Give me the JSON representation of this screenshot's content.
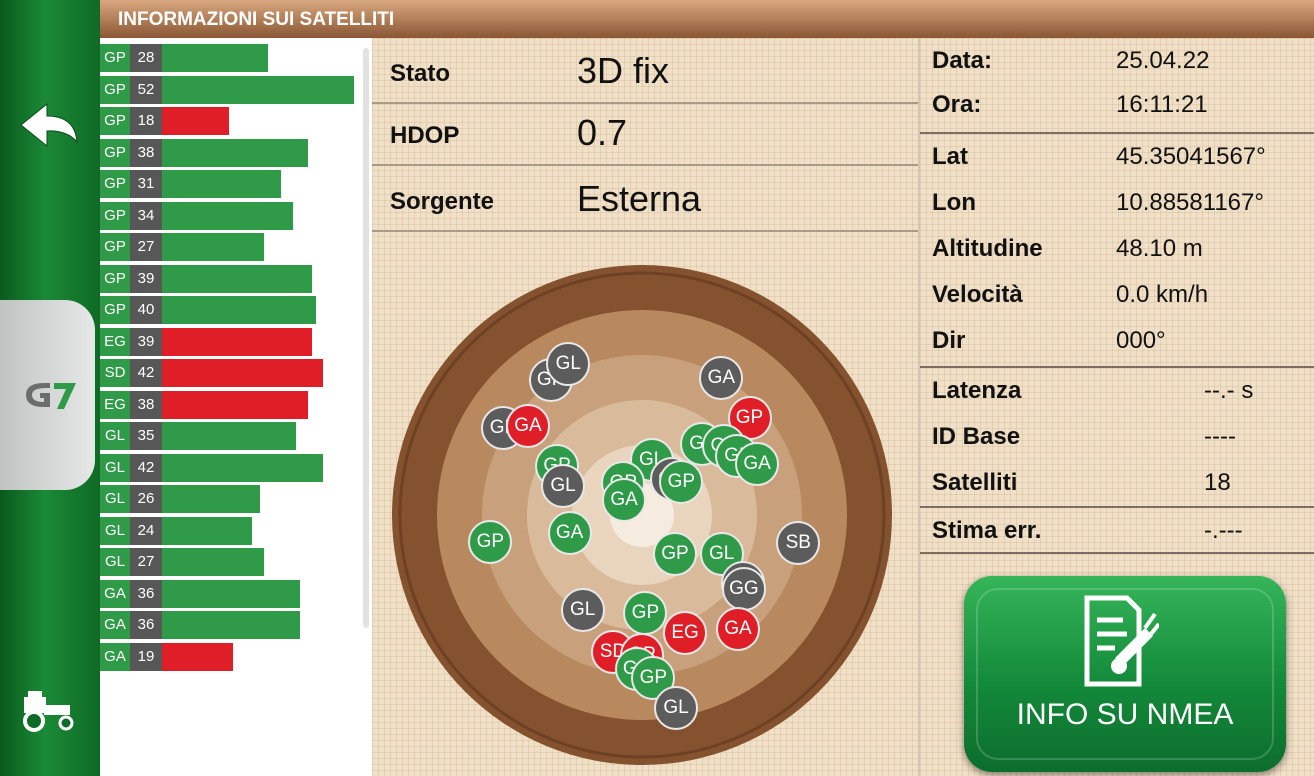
{
  "title": "INFORMAZIONI SUI SATELLITI",
  "sidebar": {
    "back_icon": "back-arrow-icon",
    "logo_icon": "g7-logo-icon",
    "tractor_icon": "tractor-icon"
  },
  "colors": {
    "good": "#2f9a48",
    "weak": "#e01e28",
    "inactive": "#5c5c5c",
    "accent": "#8a5634"
  },
  "satellites": [
    {
      "cons": "GP",
      "snr": "28",
      "level": 0.55,
      "status": "good"
    },
    {
      "cons": "GP",
      "snr": "52",
      "level": 1.0,
      "status": "good"
    },
    {
      "cons": "GP",
      "snr": "18",
      "level": 0.35,
      "status": "weak"
    },
    {
      "cons": "GP",
      "snr": "38",
      "level": 0.76,
      "status": "good"
    },
    {
      "cons": "GP",
      "snr": "31",
      "level": 0.62,
      "status": "good"
    },
    {
      "cons": "GP",
      "snr": "34",
      "level": 0.68,
      "status": "good"
    },
    {
      "cons": "GP",
      "snr": "27",
      "level": 0.53,
      "status": "good"
    },
    {
      "cons": "GP",
      "snr": "39",
      "level": 0.78,
      "status": "good"
    },
    {
      "cons": "GP",
      "snr": "40",
      "level": 0.8,
      "status": "good"
    },
    {
      "cons": "EG",
      "snr": "39",
      "level": 0.78,
      "status": "weak"
    },
    {
      "cons": "SD",
      "snr": "42",
      "level": 0.84,
      "status": "weak"
    },
    {
      "cons": "EG",
      "snr": "38",
      "level": 0.76,
      "status": "weak"
    },
    {
      "cons": "GL",
      "snr": "35",
      "level": 0.7,
      "status": "good"
    },
    {
      "cons": "GL",
      "snr": "42",
      "level": 0.84,
      "status": "good"
    },
    {
      "cons": "GL",
      "snr": "26",
      "level": 0.51,
      "status": "good"
    },
    {
      "cons": "GL",
      "snr": "24",
      "level": 0.47,
      "status": "good"
    },
    {
      "cons": "GL",
      "snr": "27",
      "level": 0.53,
      "status": "good"
    },
    {
      "cons": "GA",
      "snr": "36",
      "level": 0.72,
      "status": "good"
    },
    {
      "cons": "GA",
      "snr": "36",
      "level": 0.72,
      "status": "good"
    },
    {
      "cons": "GA",
      "snr": "19",
      "level": 0.37,
      "status": "weak"
    }
  ],
  "status": {
    "stato_label": "Stato",
    "stato_value": "3D fix",
    "hdop_label": "HDOP",
    "hdop_value": "0.7",
    "sorgente_label": "Sorgente",
    "sorgente_value": "Esterna"
  },
  "sky": [
    {
      "l": "GP",
      "s": "gray",
      "az": 326,
      "el": 20
    },
    {
      "l": "GL",
      "s": "gray",
      "az": 334,
      "el": 18
    },
    {
      "l": "GA",
      "s": "gray",
      "az": 30,
      "el": 22
    },
    {
      "l": "GP",
      "s": "red",
      "az": 48,
      "el": 28
    },
    {
      "l": "GP",
      "s": "gray",
      "az": 302,
      "el": 20
    },
    {
      "l": "GA",
      "s": "red",
      "az": 308,
      "el": 28
    },
    {
      "l": "GL",
      "s": "green",
      "az": 40,
      "el": 50
    },
    {
      "l": "GP",
      "s": "green",
      "az": 50,
      "el": 44
    },
    {
      "l": "GL",
      "s": "green",
      "az": 58,
      "el": 42
    },
    {
      "l": "GA",
      "s": "green",
      "az": 66,
      "el": 36
    },
    {
      "l": "GL",
      "s": "green",
      "az": 10,
      "el": 66
    },
    {
      "l": "GA",
      "s": "gray",
      "az": 40,
      "el": 70
    },
    {
      "l": "GP",
      "s": "green",
      "az": 50,
      "el": 68
    },
    {
      "l": "GP",
      "s": "green",
      "az": 300,
      "el": 48
    },
    {
      "l": "GL",
      "s": "gray",
      "az": 290,
      "el": 54
    },
    {
      "l": "GP",
      "s": "green",
      "az": 330,
      "el": 74
    },
    {
      "l": "GA",
      "s": "green",
      "az": 310,
      "el": 80
    },
    {
      "l": "GA",
      "s": "green",
      "az": 256,
      "el": 58
    },
    {
      "l": "GP",
      "s": "green",
      "az": 260,
      "el": 24
    },
    {
      "l": "GP",
      "s": "green",
      "az": 140,
      "el": 68
    },
    {
      "l": "GL",
      "s": "green",
      "az": 116,
      "el": 52
    },
    {
      "l": "SB",
      "s": "gray",
      "az": 100,
      "el": 22
    },
    {
      "l": "EG",
      "s": "gray",
      "az": 124,
      "el": 38
    },
    {
      "l": "GG",
      "s": "gray",
      "az": 126,
      "el": 36
    },
    {
      "l": "GL",
      "s": "gray",
      "az": 212,
      "el": 42
    },
    {
      "l": "GP",
      "s": "green",
      "az": 178,
      "el": 48
    },
    {
      "l": "SD",
      "s": "red",
      "az": 192,
      "el": 30
    },
    {
      "l": "EG",
      "s": "red",
      "az": 160,
      "el": 36
    },
    {
      "l": "GA",
      "s": "red",
      "az": 140,
      "el": 26
    },
    {
      "l": "GP",
      "s": "red",
      "az": 180,
      "el": 30
    },
    {
      "l": "GA",
      "s": "green",
      "az": 182,
      "el": 24
    },
    {
      "l": "GP",
      "s": "green",
      "az": 176,
      "el": 20
    },
    {
      "l": "GL",
      "s": "gray",
      "az": 170,
      "el": 6
    }
  ],
  "info": {
    "data_label": "Data:",
    "data_value": "25.04.22",
    "ora_label": "Ora:",
    "ora_value": "16:11:21",
    "lat_label": "Lat",
    "lat_value": "45.35041567°",
    "lon_label": "Lon",
    "lon_value": "10.88581167°",
    "alt_label": "Altitudine",
    "alt_value": "48.10 m",
    "vel_label": "Velocità",
    "vel_value": "0.0 km/h",
    "dir_label": "Dir",
    "dir_value": "000°",
    "latenza_label": "Latenza",
    "latenza_value": "--.- s",
    "idbase_label": "ID Base",
    "idbase_value": "----",
    "sat_label": "Satelliti",
    "sat_value": "18",
    "stima_label": "Stima err.",
    "stima_value": "-.---"
  },
  "nmea_button": {
    "label": "INFO SU NMEA",
    "icon": "nmea-document-icon"
  }
}
